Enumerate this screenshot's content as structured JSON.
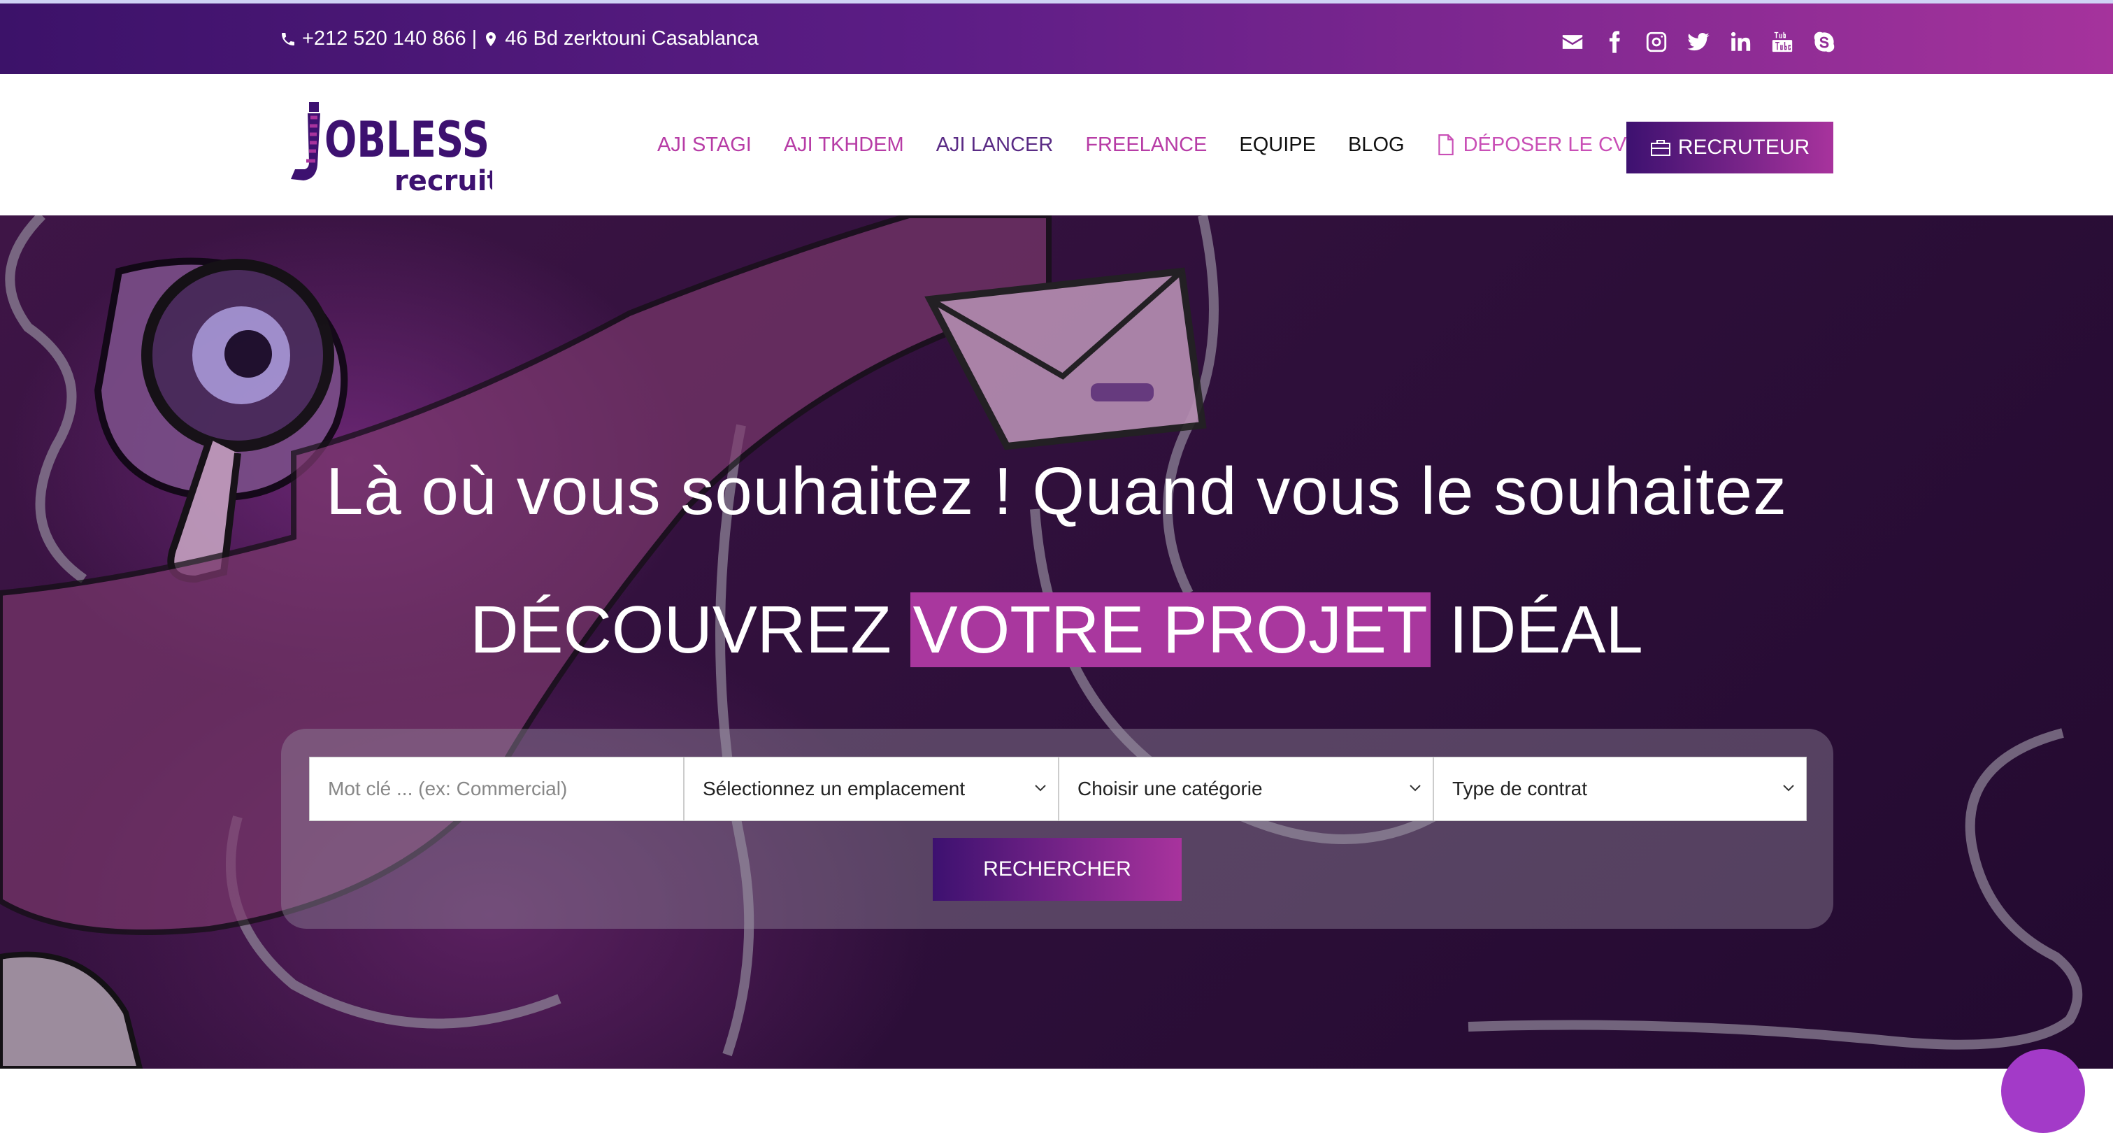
{
  "topbar": {
    "phone": "+212 520 140 866",
    "separator": "|",
    "address": "46 Bd zerktouni Casablanca",
    "social_icons": [
      "envelope-icon",
      "facebook-icon",
      "instagram-icon",
      "twitter-icon",
      "linkedin-icon",
      "youtube-icon",
      "skype-icon"
    ]
  },
  "header": {
    "logo_text_main": "OBLESS",
    "logo_text_sub": "recruit",
    "nav": [
      {
        "label": "AJI STAGI"
      },
      {
        "label": "AJI TKHDEM"
      },
      {
        "label": "AJI LANCER"
      },
      {
        "label": "FREELANCE"
      },
      {
        "label": "EQUIPE"
      },
      {
        "label": "BLOG"
      },
      {
        "label": "DÉPOSER LE CV"
      }
    ],
    "recruteur_label": "RECRUTEUR"
  },
  "hero": {
    "headline": "Là où vous souhaitez ! Quand vous le souhaitez",
    "sub_before": "DÉCOUVREZ ",
    "sub_highlight": "VOTRE PROJET",
    "sub_after": " IDÉAL"
  },
  "search": {
    "keyword_placeholder": "Mot clé ... (ex: Commercial)",
    "location_value": "Sélectionnez un emplacement",
    "category_value": "Choisir une catégorie",
    "contract_value": "Type de contrat",
    "button_label": "RECHERCHER"
  },
  "colors": {
    "brand_dark": "#3d1170",
    "brand_pink": "#a8339d",
    "nav_pink": "#b73ca6"
  }
}
